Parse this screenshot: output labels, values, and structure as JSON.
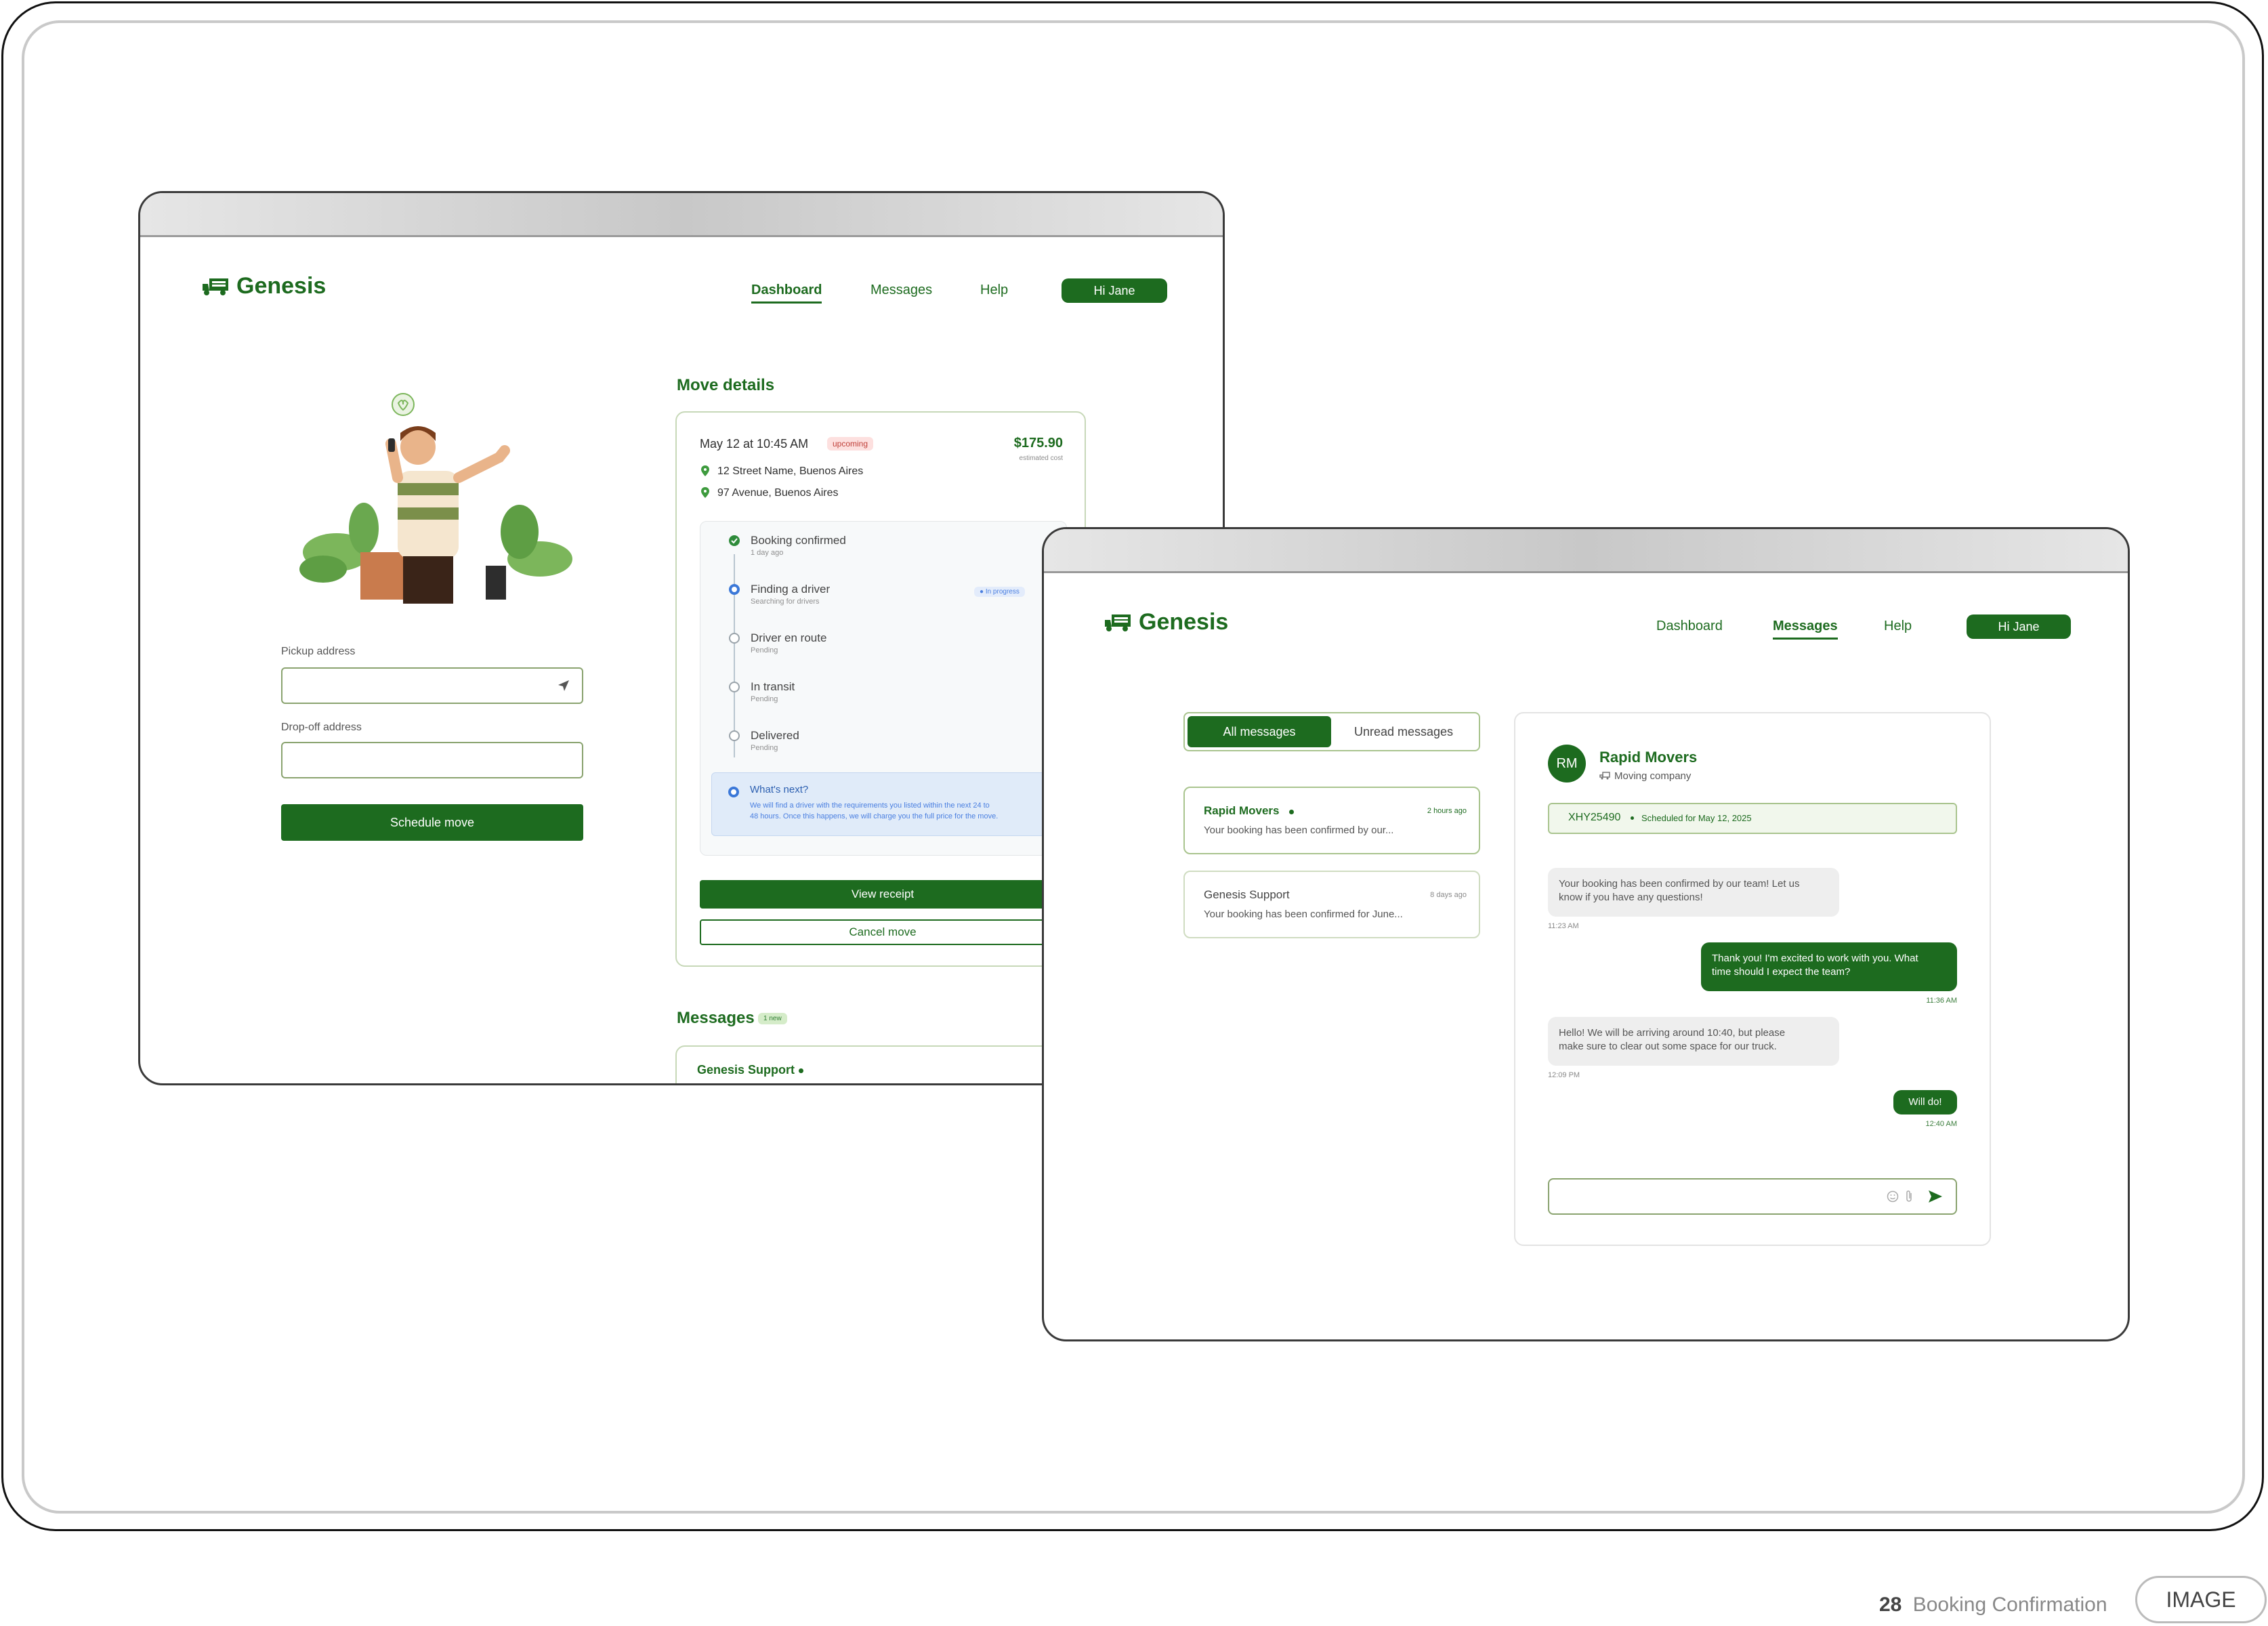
{
  "footer": {
    "page_number": "28",
    "section_title": "Booking Confirmation",
    "tag_label": "IMAGE"
  },
  "dashboard_window": {
    "brand": "Genesis",
    "nav": {
      "dashboard": "Dashboard",
      "messages": "Messages",
      "help": "Help",
      "user_button": "Hi Jane"
    },
    "form": {
      "pickup_label": "Pickup address",
      "pickup_value": "",
      "dropoff_label": "Drop-off address",
      "dropoff_value": "",
      "schedule_button": "Schedule move"
    },
    "move_details": {
      "title": "Move details",
      "date": "May 12 at 10:45 AM",
      "status_badge": "upcoming",
      "price": "$175.90",
      "price_note": "estimated cost",
      "from_address": "12 Street Name, Buenos Aires",
      "to_address": "97 Avenue, Buenos Aires",
      "steps": [
        {
          "title": "Booking confirmed",
          "sub": "1 day ago"
        },
        {
          "title": "Finding a driver",
          "sub": "Searching for drivers",
          "badge": "● In progress"
        },
        {
          "title": "Driver en route",
          "sub": "Pending"
        },
        {
          "title": "In transit",
          "sub": "Pending"
        },
        {
          "title": "Delivered",
          "sub": "Pending"
        }
      ],
      "whats_next_title": "What's next?",
      "whats_next_line1": "We will find a driver with the requirements you listed within the next 24 to",
      "whats_next_line2": "48 hours. Once this happens, we will charge you the full price for the move.",
      "view_receipt": "View receipt",
      "cancel_move": "Cancel move"
    },
    "messages_section": {
      "title": "Messages",
      "badge": "1 new",
      "first_sender": "Genesis Support"
    }
  },
  "messages_window": {
    "brand": "Genesis",
    "nav": {
      "dashboard": "Dashboard",
      "messages": "Messages",
      "help": "Help",
      "user_button": "Hi Jane"
    },
    "tabs": {
      "all": "All messages",
      "unread": "Unread messages"
    },
    "threads": [
      {
        "sender": "Rapid Movers",
        "time": "2 hours ago",
        "preview": "Your booking has been confirmed by our...",
        "unread": true
      },
      {
        "sender": "Genesis Support",
        "time": "8 days ago",
        "preview": "Your booking has been confirmed for June...",
        "unread": false
      }
    ],
    "conversation": {
      "avatar_initials": "RM",
      "name": "Rapid Movers",
      "subtitle": "Moving company",
      "booking_code": "XHY25490",
      "booking_schedule": "Scheduled for May 12, 2025",
      "messages": [
        {
          "dir": "in",
          "line1": "Your booking has been confirmed by our team! Let us",
          "line2": "know if you have any questions!",
          "time": "11:23 AM"
        },
        {
          "dir": "out",
          "line1": "Thank you! I'm excited to work with you. What",
          "line2": "time should I expect the team?",
          "time": "11:36 AM"
        },
        {
          "dir": "in",
          "line1": "Hello! We will be arriving around 10:40, but please",
          "line2": "make sure to clear out some space for our truck.",
          "time": "12:09 PM"
        },
        {
          "dir": "out",
          "line1": "Will do!",
          "line2": "",
          "time": "12:40 AM"
        }
      ],
      "composer_placeholder": ""
    }
  },
  "colors": {
    "brand_green": "#1d6b1f",
    "light_green_border": "#a9c48e",
    "info_blue": "#4a7fe0"
  }
}
